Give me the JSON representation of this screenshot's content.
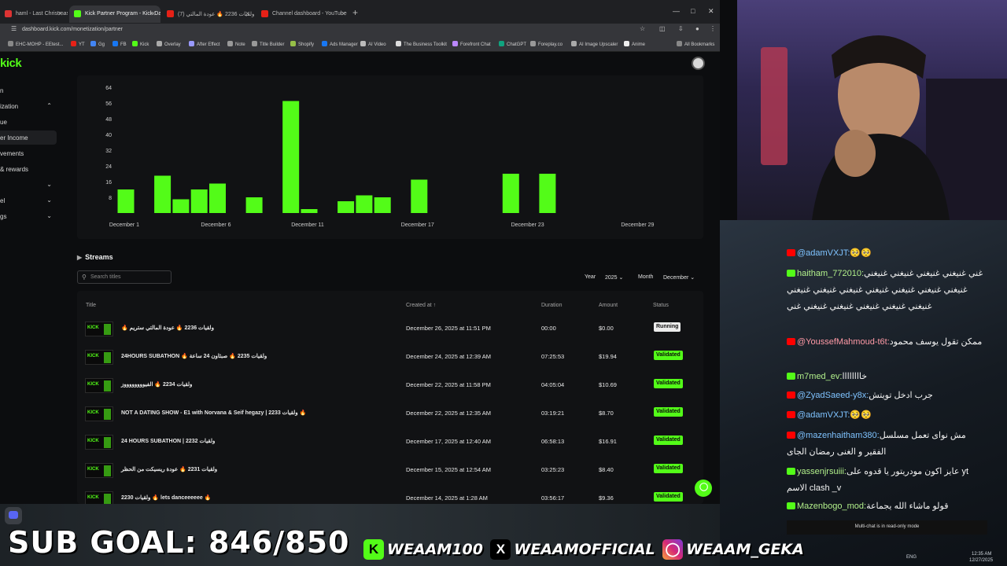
{
  "browser": {
    "tabs": [
      {
        "label": "haml - Last Christmas By",
        "fav": "#d33",
        "active": false
      },
      {
        "label": "Kick Partner Program - Kick Da",
        "fav": "#53fc18",
        "active": true
      },
      {
        "label": "(7) ولقيات 2236 🔥 عودة المالتي",
        "fav": "#e62117",
        "active": false
      },
      {
        "label": "Channel dashboard - YouTube",
        "fav": "#e62117",
        "active": false
      }
    ],
    "url": "dashboard.kick.com/monetization/partner",
    "bookmarks": [
      "EHC-MOHP - EEtest...",
      "YT",
      "Gg",
      "FB",
      "Kick",
      "Overlay",
      "After Effect",
      "Note",
      "Title Builder",
      "Shopify",
      "Ads Manager",
      "AI Video",
      "The Business Toolkit",
      "Forefront Chat",
      "ChatGPT",
      "Foreplay.co",
      "AI Image Upscaler",
      "Anime",
      "All Bookmarks"
    ]
  },
  "kick": {
    "logo": "kick",
    "sidebar": [
      {
        "label": "n",
        "chev": ""
      },
      {
        "label": "ization",
        "chev": "⌃"
      },
      {
        "label": "ue",
        "chev": ""
      },
      {
        "label": "er Income",
        "chev": ""
      },
      {
        "label": "vements",
        "chev": ""
      },
      {
        "label": "& rewards",
        "chev": ""
      },
      {
        "label": "",
        "chev": "⌄"
      },
      {
        "label": "el",
        "chev": "⌄"
      },
      {
        "label": "gs",
        "chev": "⌄"
      }
    ]
  },
  "chart_data": {
    "type": "bar",
    "y_ticks": [
      8,
      16,
      24,
      32,
      40,
      48,
      56,
      64
    ],
    "ylim": [
      0,
      64
    ],
    "x_tick_labels": [
      "December 1",
      "December 6",
      "December 11",
      "December 17",
      "December 23",
      "December 29"
    ],
    "x_tick_days": [
      1,
      6,
      11,
      17,
      23,
      29
    ],
    "bars": [
      {
        "day": 1,
        "value": 12
      },
      {
        "day": 3,
        "value": 19
      },
      {
        "day": 4,
        "value": 7
      },
      {
        "day": 5,
        "value": 12
      },
      {
        "day": 6,
        "value": 15
      },
      {
        "day": 8,
        "value": 8
      },
      {
        "day": 10,
        "value": 57
      },
      {
        "day": 11,
        "value": 2
      },
      {
        "day": 13,
        "value": 6
      },
      {
        "day": 14,
        "value": 9
      },
      {
        "day": 15,
        "value": 8
      },
      {
        "day": 17,
        "value": 17
      },
      {
        "day": 22,
        "value": 20
      },
      {
        "day": 24,
        "value": 20
      }
    ],
    "bar_color": "#53fc18",
    "grid": false
  },
  "streams": {
    "heading": "Streams",
    "search_placeholder": "Search titles",
    "year_label": "Year",
    "year_value": "2025",
    "month_label": "Month",
    "month_value": "December",
    "columns": [
      "Title",
      "Created at",
      "Duration",
      "Amount",
      "Status"
    ],
    "rows": [
      {
        "title": "🔥 ولقيات 2236 🔥 عودة المالتي ستريم",
        "created": "December 26, 2025 at 11:51 PM",
        "duration": "00:00",
        "amount": "$0.00",
        "status": "Running"
      },
      {
        "title": "24HOURS SUBATHON 🔥 ولقيات 2235 🔥 صبثاون 24 ساعة",
        "created": "December 24, 2025 at 12:39 AM",
        "duration": "07:25:53",
        "amount": "$19.94",
        "status": "Validated"
      },
      {
        "title": "ولقيات 2234 🔥 الفيووووووووز",
        "created": "December 22, 2025 at 11:58 PM",
        "duration": "04:05:04",
        "amount": "$10.69",
        "status": "Validated"
      },
      {
        "title": "NOT A DATING SHOW - E1 with Norvana & Seif hegazy | 2233 ولقيات 🔥",
        "created": "December 22, 2025 at 12:35 AM",
        "duration": "03:19:21",
        "amount": "$8.70",
        "status": "Validated"
      },
      {
        "title": "24 HOURS SUBATHON | 2232 ولقيات",
        "created": "December 17, 2025 at 12:40 AM",
        "duration": "06:58:13",
        "amount": "$16.91",
        "status": "Validated"
      },
      {
        "title": "ولقيات 2231 🔥 عودة ريسيكت من الحظر",
        "created": "December 15, 2025 at 12:54 AM",
        "duration": "03:25:23",
        "amount": "$8.40",
        "status": "Validated"
      },
      {
        "title": "2230 ولقيات 🔥 lets danceeeeee 🔥",
        "created": "December 14, 2025 at 1:28 AM",
        "duration": "03:56:17",
        "amount": "$9.36",
        "status": "Validated"
      }
    ]
  },
  "chat": {
    "messages": [
      {
        "platform": "youtube",
        "user": "@adamVXJT:",
        "text": "🥺🥺"
      },
      {
        "platform": "kick",
        "user": "haitham_772010:",
        "text": "غني غنيغني غنيغني غنيغني غنيغني غنيغني غنيغني غنيغني غنيغني غنيغني غنيغني غنيغني غنيغني غنيغني غنيغني غنيغني غنيغني غني"
      },
      {
        "platform": "youtube",
        "user": "@YoussefMahmoud-t6t:",
        "text": "ممكن تقول يوسف محمود"
      },
      {
        "platform": "kick",
        "user": "m7med_ev:",
        "text": "خاااااااا"
      },
      {
        "platform": "youtube",
        "user": "@ZyadSaeed-y8x:",
        "text": "جرب ادخل تويتش"
      },
      {
        "platform": "youtube",
        "user": "@adamVXJT:",
        "text": "🥺🥺"
      },
      {
        "platform": "youtube",
        "user": "@mazenhaitham380:",
        "text": "مش نواى تعمل مسلسل الفقير و الغنى رمضان الجاى"
      },
      {
        "platform": "kick",
        "user": "yassenjrsuiii:",
        "text": "عايز اكون مودريتور يا قدوه على yt الاسم clash _v"
      },
      {
        "platform": "kick",
        "user": "Mazenbogo_mod:",
        "text": "قولو ماشاء الله يجماعة"
      }
    ],
    "readonly_note": "Multi-chat is in read-only mode"
  },
  "overlay": {
    "sub_goal": "SUB GOAL: 846/850",
    "kick_handle": "WEAAM100",
    "x_handle": "WEAAMOFFICIAL",
    "instagram_handle": "WEAAM_GEKA"
  },
  "taskbar": {
    "lang": "ENG",
    "time": "12:35 AM",
    "date": "12/27/2025"
  },
  "colors": {
    "kick_green": "#53fc18",
    "page_bg": "#0c0d0f",
    "card_bg": "#111214"
  }
}
